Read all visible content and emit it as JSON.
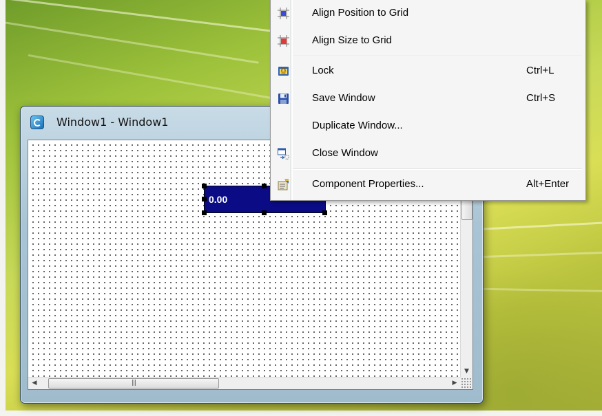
{
  "desktop": {
    "window": {
      "title": "Window1 - Window1",
      "selected_field": {
        "value": "0.00"
      }
    }
  },
  "context_menu": {
    "items": [
      {
        "label": "Align Position to Grid",
        "shortcut": "",
        "icon": "align-position-icon"
      },
      {
        "label": "Align Size to Grid",
        "shortcut": "",
        "icon": "align-size-icon"
      },
      {
        "label": "Lock",
        "shortcut": "Ctrl+L",
        "icon": "lock-icon"
      },
      {
        "label": "Save Window",
        "shortcut": "Ctrl+S",
        "icon": "save-icon"
      },
      {
        "label": "Duplicate Window...",
        "shortcut": "",
        "icon": ""
      },
      {
        "label": "Close Window",
        "shortcut": "",
        "icon": "close-window-icon"
      },
      {
        "label": "Component Properties...",
        "shortcut": "Alt+Enter",
        "icon": "properties-icon"
      }
    ]
  },
  "colors": {
    "selection": "#0b0b86",
    "menu_background": "#f5f5f5"
  }
}
